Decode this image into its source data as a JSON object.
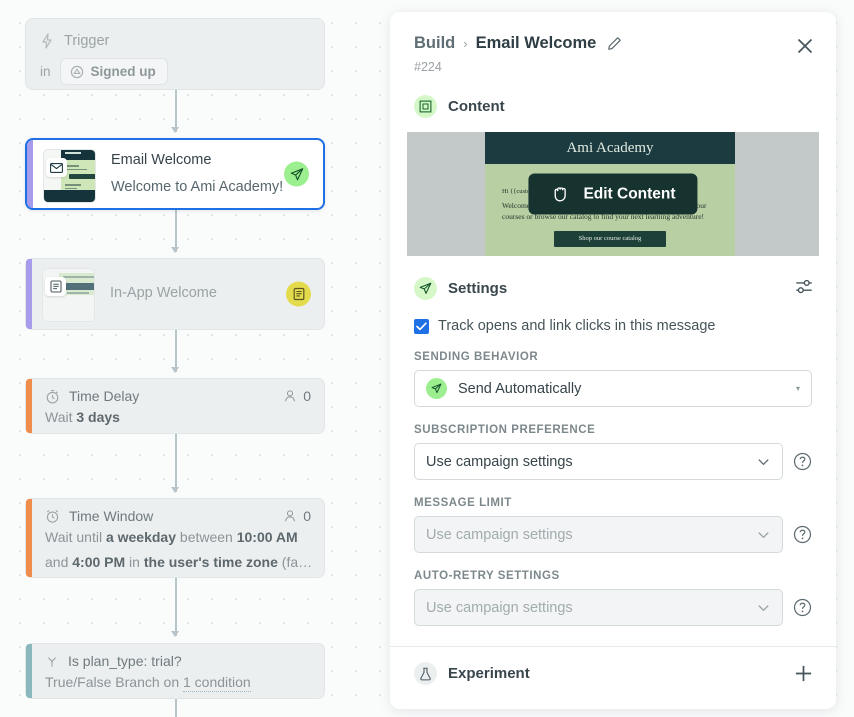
{
  "flow": {
    "trigger": {
      "title": "Trigger",
      "in_label": "in",
      "event": "Signed up",
      "event_icon": "hexagon-icon",
      "icon": "lightning-icon"
    },
    "nodes": [
      {
        "id": "email-welcome",
        "title": "Email Welcome",
        "subtitle": "Welcome to Ami Academy!",
        "badge_icon": "paper-plane-icon",
        "selected": true,
        "thumb_brand": "Academy"
      },
      {
        "id": "in-app-welcome",
        "title": "In-App Welcome",
        "subtitle": "",
        "badge_icon": "document-icon",
        "selected": false
      },
      {
        "id": "time-delay",
        "title": "Time Delay",
        "icon": "stopwatch-icon",
        "count_icon": "person-icon",
        "count": "0",
        "desc_prefix": "Wait ",
        "desc_bold": "3 days",
        "desc_suffix": ""
      },
      {
        "id": "time-window",
        "title": "Time Window",
        "icon": "alarm-clock-icon",
        "count_icon": "person-icon",
        "count": "0",
        "line1_a": "Wait until ",
        "line1_b": "a weekday",
        "line1_c": " between ",
        "line1_d": "10:00 AM",
        "line2_a": "and ",
        "line2_b": "4:00 PM",
        "line2_c": " in ",
        "line2_d": "the user's time zone",
        "line2_e": " (fa…"
      },
      {
        "id": "branch",
        "title": "Is plan_type: trial?",
        "icon": "branch-icon",
        "desc_prefix": "True/False Branch on ",
        "desc_link": "1 condition"
      }
    ]
  },
  "panel": {
    "breadcrumb": {
      "root": "Build",
      "separator": "›",
      "current": "Email Welcome",
      "edit_icon": "pencil-icon"
    },
    "id_label": "#224",
    "close_icon": "close-icon",
    "content_section": {
      "title": "Content",
      "icon": "content-frame-icon"
    },
    "preview": {
      "brand": "Ami Academy",
      "greeting": "Hi {{customer.first_name}},",
      "paragraph": "Welcome to Ami Academy! We're thrilled to have you. Pick up your courses or browse our catalog to find your next learning adventure!",
      "cta": "Shop our course catalog",
      "overlay_label": "Edit Content",
      "overlay_icon": "hand-grab-icon"
    },
    "settings_section": {
      "title": "Settings",
      "icon": "paper-plane-icon",
      "action_icon": "sliders-icon",
      "track_checkbox": {
        "label": "Track opens and link clicks in this message",
        "checked": true
      },
      "fields": [
        {
          "label": "SENDING BEHAVIOR",
          "value": "Send Automatically",
          "icon": "paper-plane-icon",
          "disabled": false,
          "has_help": false,
          "caret": "small"
        },
        {
          "label": "SUBSCRIPTION PREFERENCE",
          "value": "Use campaign settings",
          "disabled": false,
          "has_help": true,
          "caret": "chevron"
        },
        {
          "label": "MESSAGE LIMIT",
          "placeholder": "Use campaign settings",
          "disabled": true,
          "has_help": true,
          "caret": "chevron"
        },
        {
          "label": "AUTO-RETRY SETTINGS",
          "placeholder": "Use campaign settings",
          "disabled": true,
          "has_help": true,
          "caret": "chevron"
        }
      ]
    },
    "experiment_section": {
      "title": "Experiment",
      "icon": "flask-icon",
      "action_icon": "plus-icon"
    }
  },
  "colors": {
    "selection_blue": "#1f6fe5",
    "accent_purple": "#a79bec",
    "accent_orange": "#f08c4c",
    "accent_teal": "#8ab8bd",
    "badge_green": "#9cef8e",
    "badge_yellow": "#e3da4c",
    "email_dark": "#1b3b40",
    "email_green": "#b8cfa3"
  }
}
